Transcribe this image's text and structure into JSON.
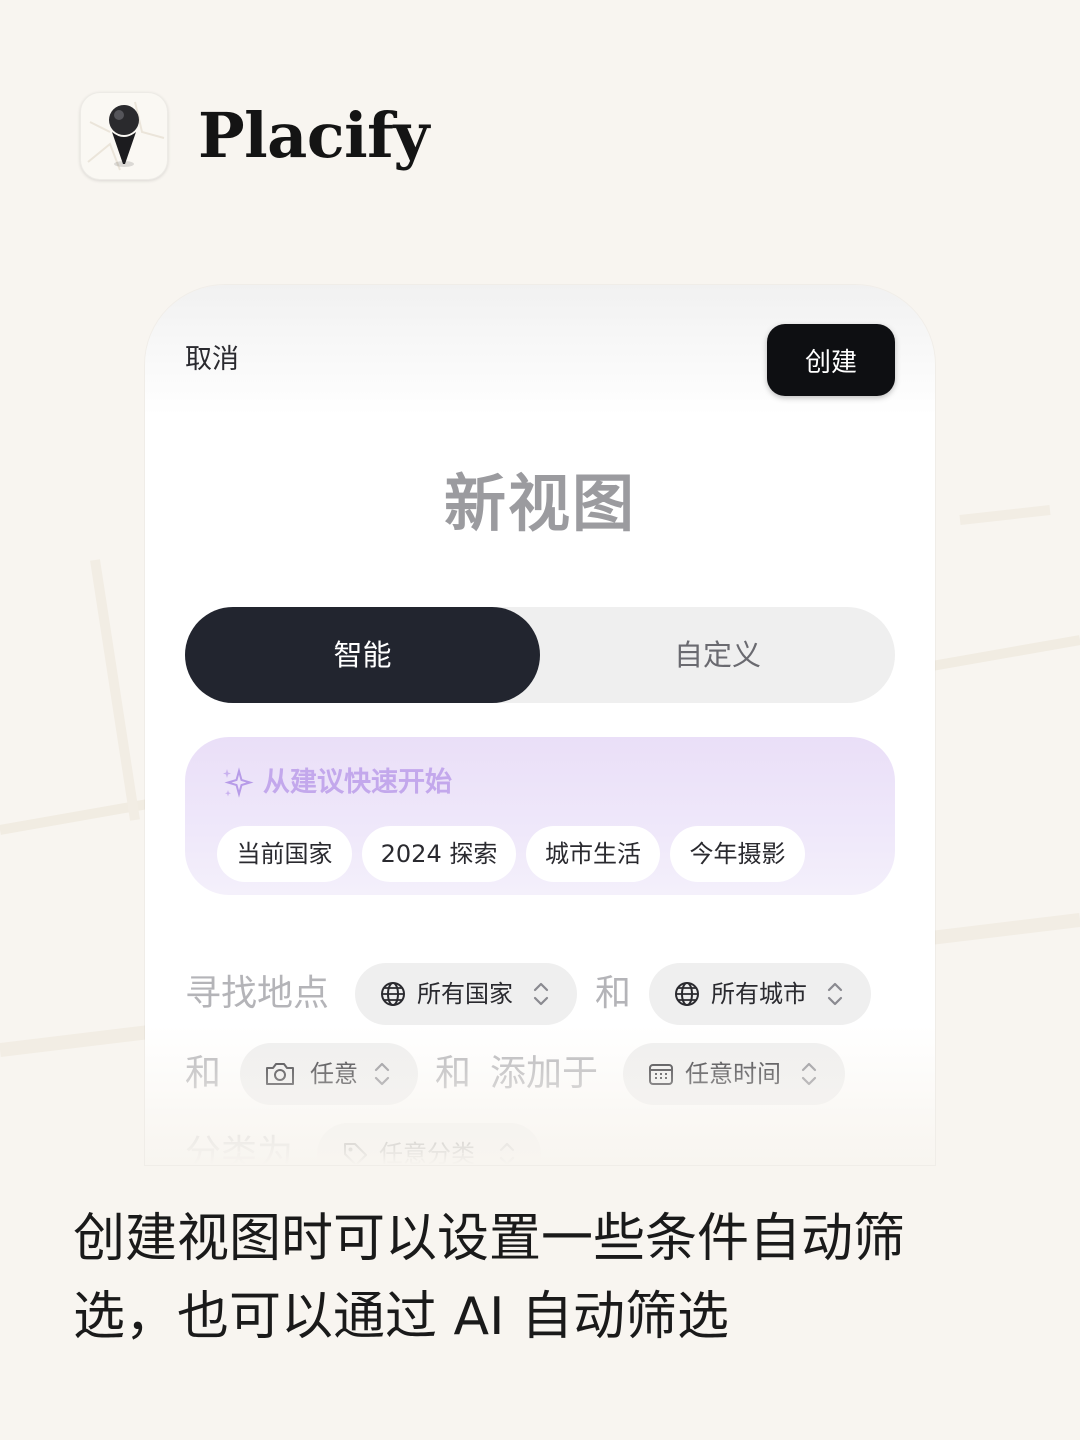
{
  "app": {
    "name": "Placify",
    "icon": "map-pin-icon"
  },
  "dialog": {
    "cancel_label": "取消",
    "create_label": "创建",
    "title": "新视图",
    "tabs": [
      {
        "label": "智能",
        "selected": true
      },
      {
        "label": "自定义",
        "selected": false
      }
    ],
    "suggestions": {
      "heading": "从建议快速开始",
      "icon": "sparkles-icon",
      "chips": [
        "当前国家",
        "2024 探索",
        "城市生活",
        "今年摄影"
      ]
    },
    "filters": {
      "find_places": "寻找地点",
      "and": "和",
      "added_at": "添加于",
      "category_as": "分类为",
      "country_select": {
        "icon": "globe-icon",
        "value": "所有国家"
      },
      "city_select": {
        "icon": "globe-icon",
        "value": "所有城市"
      },
      "photo_select": {
        "icon": "camera-icon",
        "value": "任意"
      },
      "time_select": {
        "icon": "calendar-icon",
        "value": "任意时间"
      },
      "category_select": {
        "icon": "tag-icon",
        "value": "任意分类"
      }
    }
  },
  "caption": {
    "line1": "创建视图时可以设置一些条件自动筛",
    "line2": "选，也可以通过 AI 自动筛选"
  },
  "colors": {
    "background": "#f8f5f0",
    "primary_dark": "#22252f",
    "suggestion_bg": "#eadff8",
    "suggestion_text": "#c3a8ec"
  }
}
